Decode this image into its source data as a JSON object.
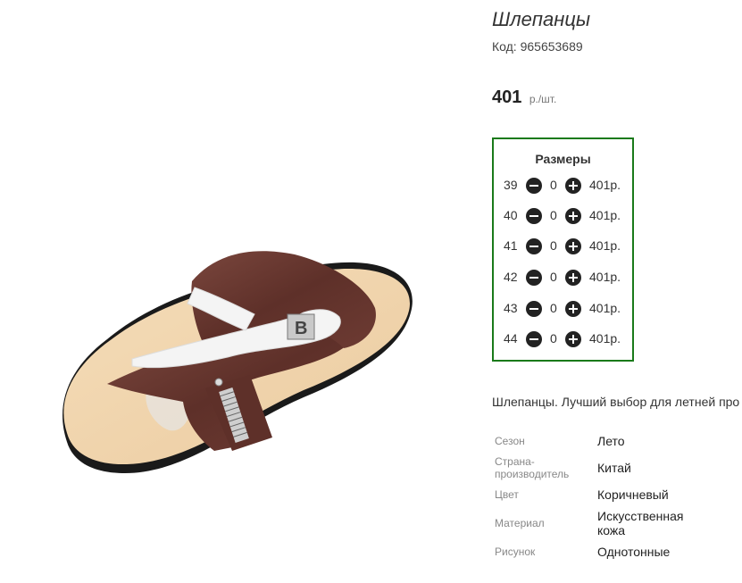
{
  "product": {
    "title": "Шлепанцы",
    "code": "Код: 965653689",
    "price": "401",
    "price_unit": "р./шт.",
    "description": "Шлепанцы. Лучший выбор для летней про"
  },
  "sizes": {
    "title": "Размеры",
    "rows": [
      {
        "size": "39",
        "qty": "0",
        "price": "401р."
      },
      {
        "size": "40",
        "qty": "0",
        "price": "401р."
      },
      {
        "size": "41",
        "qty": "0",
        "price": "401р."
      },
      {
        "size": "42",
        "qty": "0",
        "price": "401р."
      },
      {
        "size": "43",
        "qty": "0",
        "price": "401р."
      },
      {
        "size": "44",
        "qty": "0",
        "price": "401р."
      }
    ]
  },
  "attributes": [
    {
      "label": "Сезон",
      "value": "Лето"
    },
    {
      "label": "Страна-\nпроизводитель",
      "value": "Китай"
    },
    {
      "label": "Цвет",
      "value": "Коричневый"
    },
    {
      "label": "Материал",
      "value": "Искусственная\nкожа"
    },
    {
      "label": "Рисунок",
      "value": "Однотонные"
    }
  ],
  "colors": {
    "sizes_border": "#1a7a1a",
    "leather_brown": "#6b3a33",
    "sole_beige": "#f1d6b0"
  },
  "icons": {
    "minus": "minus-circle-icon",
    "plus": "plus-circle-icon"
  }
}
